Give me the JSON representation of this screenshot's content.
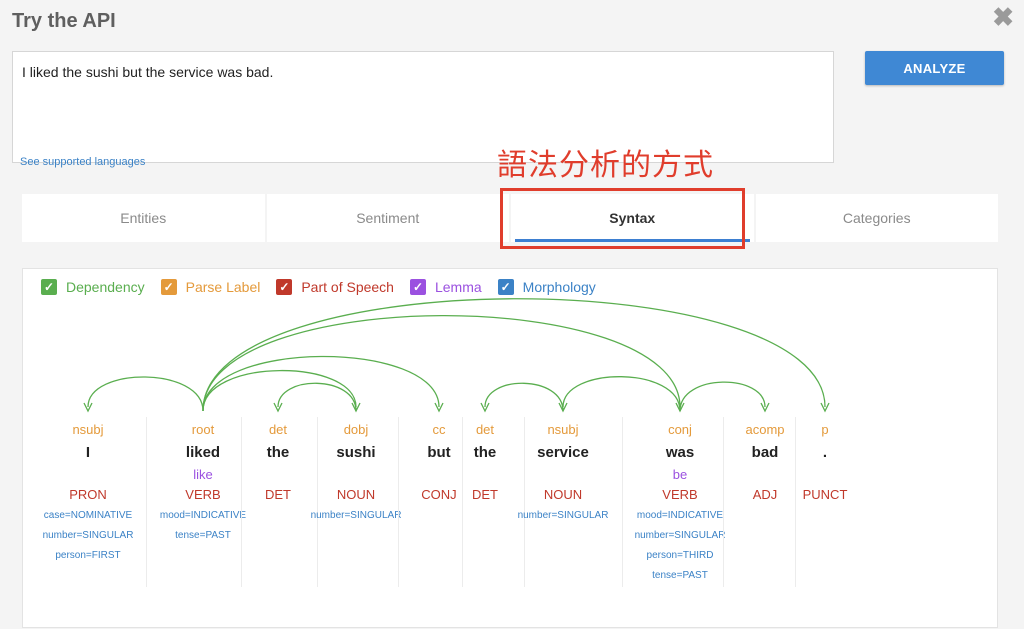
{
  "window": {
    "title": "Try the API"
  },
  "input": {
    "text": "I liked the sushi but the service was bad."
  },
  "buttons": {
    "analyze": "ANALYZE"
  },
  "links": {
    "supported_languages": "See supported languages"
  },
  "annotation": {
    "text": "語法分析的方式"
  },
  "tabs": [
    {
      "label": "Entities",
      "active": false
    },
    {
      "label": "Sentiment",
      "active": false
    },
    {
      "label": "Syntax",
      "active": true
    },
    {
      "label": "Categories",
      "active": false
    }
  ],
  "legend": [
    {
      "label": "Dependency",
      "color": "#5aae4f"
    },
    {
      "label": "Parse Label",
      "color": "#e49a3b"
    },
    {
      "label": "Part of Speech",
      "color": "#c0392b"
    },
    {
      "label": "Lemma",
      "color": "#9b51e0"
    },
    {
      "label": "Morphology",
      "color": "#3b82c6"
    }
  ],
  "tokens": [
    {
      "word": "I",
      "label": "nsubj",
      "lemma": "",
      "pos": "PRON",
      "morph": [
        "case=NOMINATIVE",
        "number=SINGULAR",
        "person=FIRST"
      ]
    },
    {
      "word": "liked",
      "label": "root",
      "lemma": "like",
      "pos": "VERB",
      "morph": [
        "mood=INDICATIVE",
        "tense=PAST"
      ]
    },
    {
      "word": "the",
      "label": "det",
      "lemma": "",
      "pos": "DET",
      "morph": []
    },
    {
      "word": "sushi",
      "label": "dobj",
      "lemma": "",
      "pos": "NOUN",
      "morph": [
        "number=SINGULAR"
      ]
    },
    {
      "word": "but",
      "label": "cc",
      "lemma": "",
      "pos": "CONJ",
      "morph": []
    },
    {
      "word": "the",
      "label": "det",
      "lemma": "",
      "pos": "DET",
      "morph": []
    },
    {
      "word": "service",
      "label": "nsubj",
      "lemma": "",
      "pos": "NOUN",
      "morph": [
        "number=SINGULAR"
      ]
    },
    {
      "word": "was",
      "label": "conj",
      "lemma": "be",
      "pos": "VERB",
      "morph": [
        "mood=INDICATIVE",
        "number=SINGULAR",
        "person=THIRD",
        "tense=PAST"
      ]
    },
    {
      "word": "bad",
      "label": "acomp",
      "lemma": "",
      "pos": "ADJ",
      "morph": []
    },
    {
      "word": ".",
      "label": "p",
      "lemma": "",
      "pos": "PUNCT",
      "morph": []
    }
  ],
  "dependencies": [
    {
      "from": 1,
      "to": 0
    },
    {
      "from": 1,
      "to": 3
    },
    {
      "from": 1,
      "to": 4
    },
    {
      "from": 1,
      "to": 7
    },
    {
      "from": 1,
      "to": 9
    },
    {
      "from": 3,
      "to": 2
    },
    {
      "from": 6,
      "to": 5
    },
    {
      "from": 7,
      "to": 6
    },
    {
      "from": 7,
      "to": 8
    }
  ]
}
